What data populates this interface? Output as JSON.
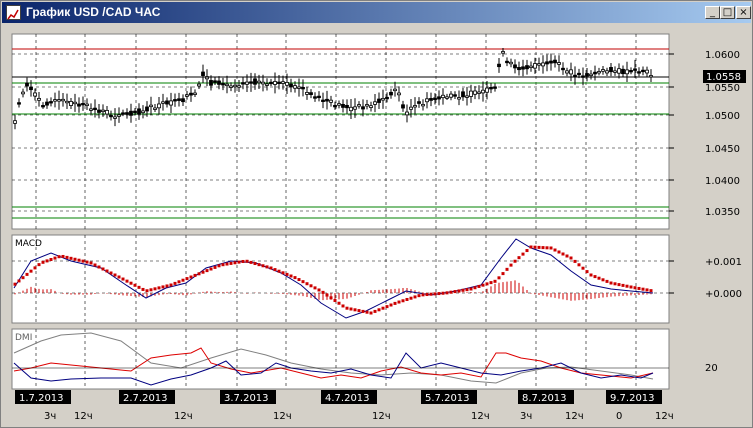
{
  "window": {
    "title": "График USD /CAD  ЧАС",
    "btn_minimize": "_",
    "btn_maximize": "□",
    "btn_close": "×"
  },
  "price_panel": {
    "current_price": "1.0558",
    "ticks": [
      "1.0600",
      "1.0550",
      "1.0500",
      "1.0450",
      "1.0400",
      "1.0350"
    ]
  },
  "macd_panel": {
    "label": "MACD",
    "ticks": [
      "+0.001",
      "+0.000"
    ]
  },
  "dmi_panel": {
    "label": "DMI",
    "ticks": [
      "20"
    ]
  },
  "time_axis": {
    "dates": [
      "1.7.2013",
      "2.7.2013",
      "3.7.2013",
      "4.7.2013",
      "5.7.2013",
      "8.7.2013",
      "9.7.2013"
    ],
    "hour_labels": [
      "3ч",
      "12ч",
      "12ч",
      "12ч",
      "12ч",
      "12ч",
      "3ч",
      "12ч",
      "0",
      "12ч"
    ]
  },
  "colors": {
    "title_bar_start": "#0a246a",
    "title_bar_end": "#a6caf0",
    "panel_bg": "#ffffff",
    "green_lines": "#008000",
    "red_line": "#c00000",
    "macd_line": "#000080",
    "macd_signal": "#cc0000",
    "dmi_plus": "#000080",
    "dmi_minus": "#dd0000",
    "dmi_adx": "#808080"
  }
}
